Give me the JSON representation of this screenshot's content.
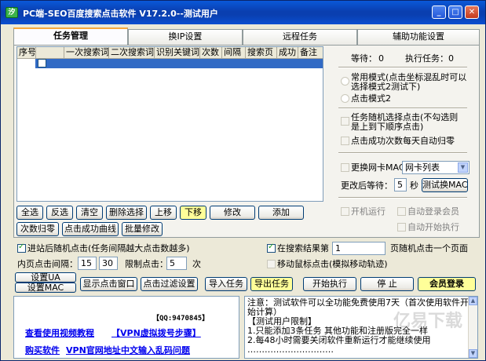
{
  "window": {
    "title": "PC端-SEO百度搜索点击软件 V17.2.0--测试用户",
    "icon_text": "汐",
    "min_glyph": "_",
    "max_glyph": "□",
    "close_glyph": "✕"
  },
  "tabs": [
    {
      "label": "任务管理",
      "active": true
    },
    {
      "label": "换IP设置",
      "active": false
    },
    {
      "label": "远程任务",
      "active": false
    },
    {
      "label": "辅助功能设置",
      "active": false
    }
  ],
  "table": {
    "columns": [
      "序号",
      "一次搜索词",
      "二次搜索词",
      "识别关键词",
      "次数",
      "间隔",
      "搜索页",
      "成功",
      "备注"
    ]
  },
  "grid_buttons": {
    "select_all": "全选",
    "invert": "反选",
    "clear": "清空",
    "delete_selected": "删除选择",
    "move_up": "上移",
    "move_down": "下移",
    "edit": "修改",
    "add": "添加",
    "reset_count": "次数归零",
    "success_curve": "点击成功曲线",
    "batch_edit": "批量修改"
  },
  "right_panel": {
    "waiting_label": "等待：",
    "waiting_value": "0",
    "executing_label": "执行任务：",
    "executing_value": "0",
    "mode_normal_line1": "常用模式(点击坐标混乱时可以",
    "mode_normal_line2": "选择模式2测试下)",
    "mode_2": "点击模式2",
    "random_task_line1": "任务随机选择点击(不勾选则",
    "random_task_line2": "是上到下顺序点击)",
    "daily_reset": "点击成功次数每天自动归零",
    "change_mac": "更换网卡MAC",
    "nic_list": "网卡列表",
    "after_change_wait": "更改后等待：",
    "wait_seconds": "5",
    "seconds_unit": "秒",
    "test_mac_button": "测试换MAC",
    "boot_run": "开机运行",
    "auto_login": "自动登录会员",
    "auto_start": "自动开始执行"
  },
  "options": {
    "random_click_after_enter": "进站后随机点击(任务间隔越大点击数越多)",
    "in_search_results": "在搜索结果第",
    "search_results_page": "1",
    "random_page_click": "页随机点击一个页面",
    "inner_page_interval_label": "内页点击间隔：",
    "interval_min": "15",
    "interval_max": "30",
    "limit_clicks_label": "限制点击：",
    "limit_clicks_value": "5",
    "times_unit": "次",
    "mouse_track": "移动鼠标点击(模拟移动轨迹)"
  },
  "bottom_buttons": {
    "set_ua": "设置UA",
    "set_mac": "设置MAC",
    "show_click_window": "显示点击窗口",
    "click_filter_settings": "点击过滤设置",
    "import_tasks": "导入任务",
    "export_tasks": "导出任务",
    "start": "开始执行",
    "stop": "停 止",
    "member_login": "会员登录"
  },
  "links": {
    "qq": "【QQ:9470845】",
    "video_tutorial": "查看使用视频教程",
    "vpn_dial_steps": "【VPN虚拟拨号步骤】",
    "buy": "购买软件",
    "vpn_site": "VPN官网地址",
    "garbled_fix": "中文输入乱码问题"
  },
  "notes": [
    "注意：测试软件可以全功能免费使用7天（首次使用软件开始计算）",
    "【测试用户限制】",
    "1.只能添加3条任务 其他功能和注册版完全一样",
    "2.每48小时需要关闭软件重新运行才能继续使用",
    "…………………………"
  ],
  "watermark": "亿易下载"
}
